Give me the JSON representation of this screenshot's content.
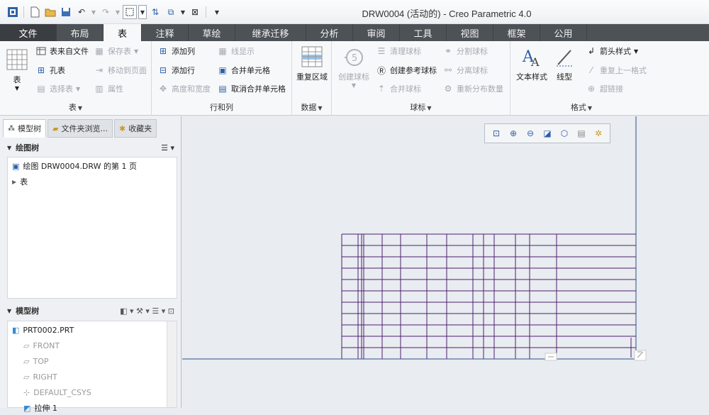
{
  "window": {
    "title": "DRW0004 (活动的) - Creo Parametric 4.0"
  },
  "tabs": [
    {
      "label": "文件",
      "w": 80
    },
    {
      "label": "布局",
      "w": 66
    },
    {
      "label": "表",
      "w": 54
    },
    {
      "label": "注释",
      "w": 66
    },
    {
      "label": "草绘",
      "w": 66
    },
    {
      "label": "继承迁移",
      "w": 100
    },
    {
      "label": "分析",
      "w": 66
    },
    {
      "label": "审阅",
      "w": 66
    },
    {
      "label": "工具",
      "w": 66
    },
    {
      "label": "视图",
      "w": 66
    },
    {
      "label": "框架",
      "w": 66
    },
    {
      "label": "公用",
      "w": 66
    }
  ],
  "ribbon": {
    "table_group": {
      "label": "表",
      "big_label": "表",
      "from_file": "表来自文件",
      "save_table": "保存表",
      "hole_table": "孔表",
      "move_to_page": "移动到页面",
      "select_table": "选择表",
      "properties": "属性"
    },
    "rows_cols": {
      "label": "行和列",
      "add_col": "添加列",
      "add_row": "添加行",
      "height_width": "高度和宽度",
      "line_display": "线显示",
      "merge_cells": "合并单元格",
      "unmerge_cells": "取消合并单元格"
    },
    "data": {
      "label": "数据",
      "repeat_region": "重复区域"
    },
    "balloons": {
      "label": "球标",
      "create_balloon": "创建球标",
      "clean_balloons": "清理球标",
      "create_ref_balloon": "创建参考球标",
      "merge_balloons": "合并球标",
      "split_balloon": "分割球标",
      "detach_balloon": "分离球标",
      "redistribute_qty": "重新分布数量"
    },
    "format": {
      "label": "格式",
      "text_style": "文本样式",
      "line_style": "线型",
      "arrow_style": "箭头样式",
      "repeat_last_format": "重复上一格式",
      "hyperlink": "超链接"
    }
  },
  "left_panel": {
    "tabs": [
      "模型树",
      "文件夹浏览...",
      "收藏夹"
    ],
    "drawing_tree": {
      "title": "绘图树",
      "items": [
        "绘图 DRW0004.DRW 的第 1 页",
        "表"
      ]
    },
    "model_tree": {
      "title": "模型树",
      "items": [
        "PRT0002.PRT",
        "FRONT",
        "TOP",
        "RIGHT",
        "DEFAULT_CSYS",
        "拉伸 1"
      ]
    }
  },
  "colors": {
    "table_line": "#4b1f6f",
    "border_line": "#2d4f8a",
    "accent": "#2b5fa8"
  }
}
